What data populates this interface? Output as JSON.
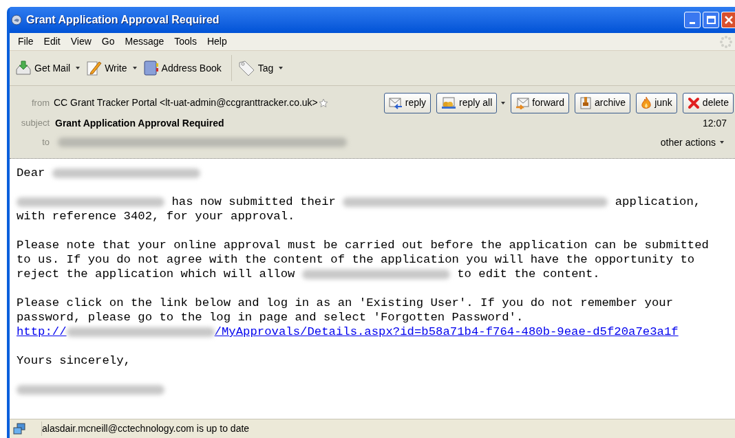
{
  "window": {
    "title": "Grant Application Approval Required"
  },
  "menu": [
    {
      "label": "File"
    },
    {
      "label": "Edit"
    },
    {
      "label": "View"
    },
    {
      "label": "Go"
    },
    {
      "label": "Message"
    },
    {
      "label": "Tools"
    },
    {
      "label": "Help"
    }
  ],
  "toolbar": [
    {
      "label": "Get Mail",
      "kind": "inbox",
      "dropdown": true
    },
    {
      "label": "Write",
      "kind": "pencil",
      "dropdown": true
    },
    {
      "label": "Address Book",
      "kind": "book",
      "dropdown": false
    },
    {
      "label": "Tag",
      "kind": "tag",
      "dropdown": true
    }
  ],
  "header": {
    "from_label": "from",
    "from": "CC Grant Tracker Portal <lt-uat-admin@ccgranttracker.co.uk>",
    "subject_label": "subject",
    "subject": "Grant Application Approval Required",
    "to_label": "to",
    "time": "12:07",
    "other_actions": "other actions",
    "buttons": [
      {
        "label": "reply",
        "kind": "reply",
        "dropdown": false
      },
      {
        "label": "reply all",
        "kind": "reply-all",
        "dropdown": true
      },
      {
        "label": "forward",
        "kind": "forward",
        "dropdown": false
      },
      {
        "label": "archive",
        "kind": "archive",
        "dropdown": false
      },
      {
        "label": "junk",
        "kind": "flame",
        "dropdown": false
      },
      {
        "label": "delete",
        "kind": "cross",
        "dropdown": false
      }
    ]
  },
  "body": {
    "paragraphs": [
      [
        [
          {
            "kind": "text",
            "text": "Dear"
          },
          {
            "kind": "redacted"
          }
        ]
      ],
      [
        [
          {
            "kind": "redacted"
          },
          {
            "kind": "text",
            "text": "has now submitted their"
          },
          {
            "kind": "redacted_long"
          },
          {
            "kind": "text",
            "text": "application,"
          }
        ],
        [
          {
            "kind": "text",
            "text": "with reference 3402, for your approval."
          }
        ]
      ],
      [
        [
          {
            "kind": "text",
            "text": "Please note that your online approval must be carried out before the application can be submitted"
          }
        ],
        [
          {
            "kind": "text",
            "text": "to us. If you do not agree with the content of the application you will have the opportunity to"
          }
        ],
        [
          {
            "kind": "text",
            "text": "reject the application which will allow"
          },
          {
            "kind": "redacted"
          },
          {
            "kind": "text",
            "text": "to edit the content."
          }
        ]
      ],
      [
        [
          {
            "kind": "text",
            "text": "Please click on the link below and log in as an 'Existing User'. If you do not remember your"
          }
        ],
        [
          {
            "kind": "text",
            "text": "password, please go to the log in page and select 'Forgotten Password'."
          }
        ],
        [
          {
            "kind": "link",
            "text": "http://"
          },
          {
            "kind": "redacted"
          },
          {
            "kind": "link",
            "text": "/MyApprovals/Details.aspx?id=b58a71b4-f764-480b-9eae-d5f20a7e3a1f"
          }
        ]
      ],
      [
        [
          {
            "kind": "text",
            "text": "Yours sincerely,"
          }
        ]
      ],
      [
        [
          {
            "kind": "redacted"
          }
        ]
      ]
    ]
  },
  "status_bar": {
    "text": "alasdair.mcneill@cctechnology.com is up to date"
  }
}
